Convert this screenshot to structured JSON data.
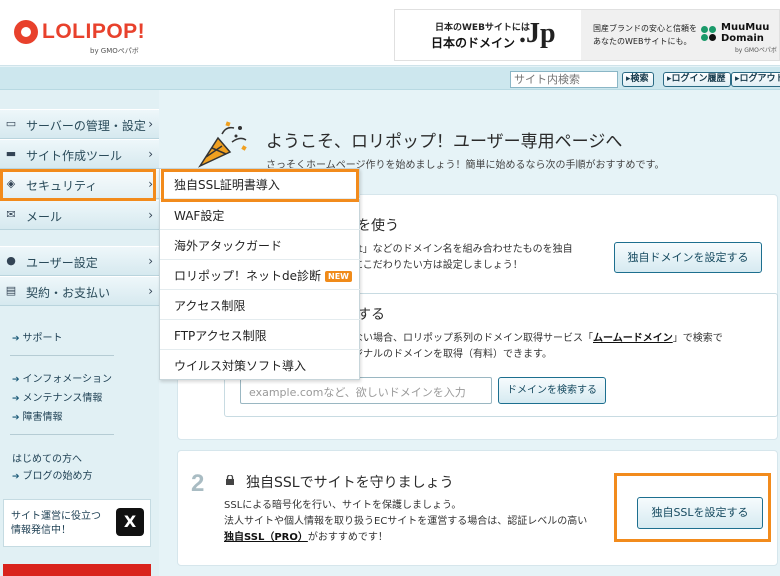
{
  "header": {
    "logo_text": "LOLIPOP!",
    "logo_sub": "by GMOペパボ",
    "banner_jp_top": "日本のWEBサイトには",
    "banner_jp_main": "日本のドメイン",
    "banner_jp_mark": ".Jp",
    "banner_mm_text_1": "国産ブランドの安心と信頼を",
    "banner_mm_text_2": "あなたのWEBサイトにも。",
    "banner_mm_logo_1": "MuuMuu",
    "banner_mm_logo_2": "Domain",
    "banner_mm_sub": "by GMOペパボ"
  },
  "toolbar": {
    "search_placeholder": "サイト内検索",
    "search_button": "▸検索",
    "login_history": "▸ログイン履歴",
    "logout": "▸ログアウト"
  },
  "sidebar": {
    "items": [
      {
        "label": "サーバーの管理・設定",
        "icon": "server-icon"
      },
      {
        "label": "サイト作成ツール",
        "icon": "monitor-icon"
      },
      {
        "label": "セキュリティ",
        "icon": "shield-icon"
      },
      {
        "label": "メール",
        "icon": "mail-icon"
      },
      {
        "label": "ユーザー設定",
        "icon": "user-icon"
      },
      {
        "label": "契約・お支払い",
        "icon": "card-icon"
      }
    ],
    "links": {
      "support": "サポート",
      "information": "インフォメーション",
      "maintenance": "メンテナンス情報",
      "trouble": "障害情報",
      "beginners": "はじめての方へ",
      "blog": "ブログの始め方"
    },
    "x_box_line1": "サイト運営に役立つ",
    "x_box_line2": "情報発信中！",
    "x_logo": "X"
  },
  "security_menu": {
    "items": [
      {
        "label": "独自SSL証明書導入"
      },
      {
        "label": "WAF設定"
      },
      {
        "label": "海外アタックガード"
      },
      {
        "label": "ロリポップ！ネットde診断",
        "badge": "NEW"
      },
      {
        "label": "アクセス制限"
      },
      {
        "label": "FTPアクセス制限"
      },
      {
        "label": "ウイルス対策ソフト導入"
      }
    ]
  },
  "main": {
    "welcome_title": "ようこそ、ロリポップ！ユーザー専用ページへ",
    "welcome_sub": "さっそくホームページ作りを始めましょう！簡単に始めるなら次の手順がおすすめです。",
    "domain": {
      "title": "ンを使う",
      "desc1": ".net」などのドメイン名を組み合わせたものを独自",
      "desc2": "ンにこだわりたい方は設定しましょう！",
      "button": "独自ドメインを設定する"
    },
    "search": {
      "title": "索する",
      "desc1_pre": "でない場合、ロリポップ系列のドメイン取得サービス「",
      "desc1_link": "ムームードメイン",
      "desc1_post": "」で検索で",
      "desc2": "リジナルのドメインを取得（有料）できます。",
      "input_placeholder": "example.comなど、欲しいドメインを入力",
      "button": "ドメインを検索する"
    },
    "ssl": {
      "step": "2",
      "title": "独自SSLでサイトを守りましょう",
      "desc1": "SSLによる暗号化を行い、サイトを保護しましょう。",
      "desc2": "法人サイトや個人情報を取り扱うECサイトを運営する場合は、認証レベルの高い",
      "desc3_link": "独自SSL（PRO）",
      "desc3_post": "がおすすめです！",
      "button": "独自SSLを設定する"
    }
  },
  "colors": {
    "brand_red": "#e8412c",
    "highlight_orange": "#f28b1c",
    "teal_bg": "#cde7ee",
    "button_border": "#1d6f8f"
  }
}
